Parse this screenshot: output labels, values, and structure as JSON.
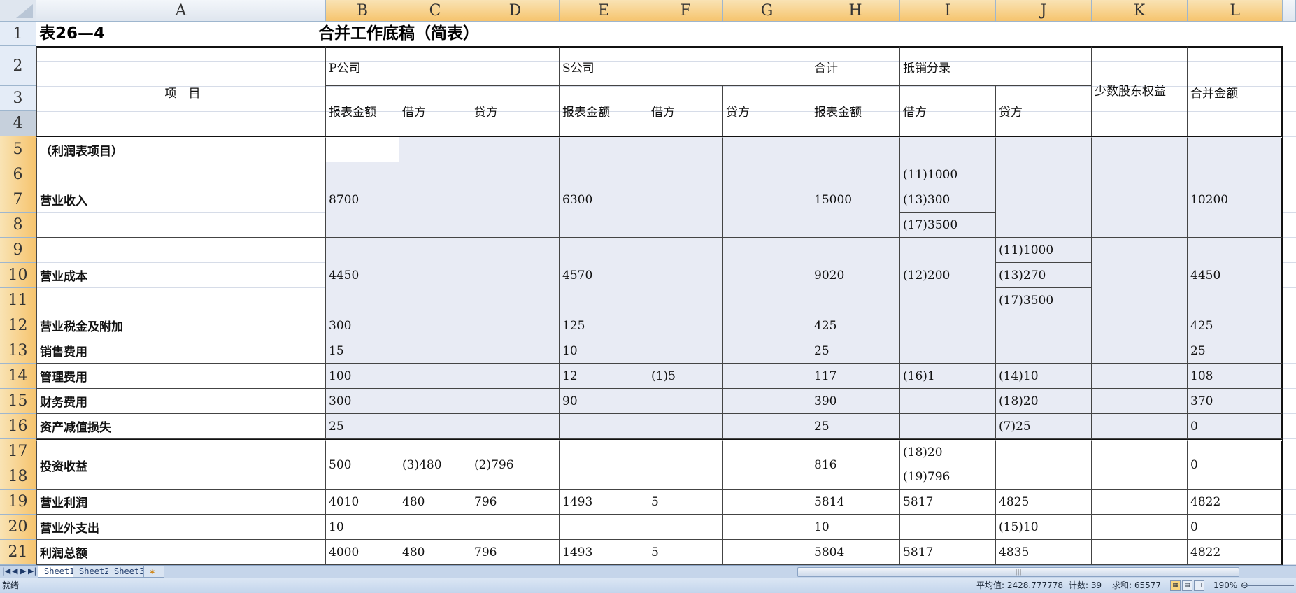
{
  "columns": [
    "A",
    "B",
    "C",
    "D",
    "E",
    "F",
    "G",
    "H",
    "I",
    "J",
    "K",
    "L"
  ],
  "rows": [
    "1",
    "2",
    "3",
    "4",
    "5",
    "6",
    "7",
    "8",
    "9",
    "10",
    "11",
    "12",
    "13",
    "14",
    "15",
    "16",
    "17",
    "18",
    "19",
    "20",
    "21"
  ],
  "title_left": "表26—4",
  "title_main": "合并工作底稿（简表）",
  "cells": [
    {
      "ref": "A2:A4",
      "text": "项　目",
      "cls": "center"
    },
    {
      "ref": "B2:D2",
      "text": "P公司"
    },
    {
      "ref": "E2:E2",
      "text": "S公司"
    },
    {
      "ref": "F2:G2",
      "text": ""
    },
    {
      "ref": "H2:H2",
      "text": "合计"
    },
    {
      "ref": "I2:J2",
      "text": "抵销分录"
    },
    {
      "ref": "K2:K4",
      "text": "少数股东权益",
      "cls": "wrap"
    },
    {
      "ref": "L2:L4",
      "text": "合并金额"
    },
    {
      "ref": "B3:B4",
      "text": "报表金额"
    },
    {
      "ref": "C3:C4",
      "text": "借方"
    },
    {
      "ref": "D3:D4",
      "text": "贷方"
    },
    {
      "ref": "E3:E4",
      "text": "报表金额"
    },
    {
      "ref": "F3:F4",
      "text": "借方"
    },
    {
      "ref": "G3:G4",
      "text": "贷方"
    },
    {
      "ref": "H3:H4",
      "text": "报表金额"
    },
    {
      "ref": "I3:I4",
      "text": "借方"
    },
    {
      "ref": "J3:J4",
      "text": "贷方"
    },
    {
      "ref": "A5",
      "text": "（利润表项目）",
      "cls": "bold"
    },
    {
      "ref": "B5",
      "text": ""
    },
    {
      "ref": "C5",
      "text": "",
      "f": 1
    },
    {
      "ref": "D5",
      "text": "",
      "f": 1
    },
    {
      "ref": "E5",
      "text": "",
      "f": 1
    },
    {
      "ref": "F5",
      "text": "",
      "f": 1
    },
    {
      "ref": "G5",
      "text": "",
      "f": 1
    },
    {
      "ref": "H5",
      "text": "",
      "f": 1
    },
    {
      "ref": "I5",
      "text": "",
      "f": 1
    },
    {
      "ref": "J5",
      "text": "",
      "f": 1
    },
    {
      "ref": "K5",
      "text": "",
      "f": 1
    },
    {
      "ref": "L5",
      "text": "",
      "f": 1
    },
    {
      "ref": "A6:A8",
      "text": "营业收入",
      "cls": "bold"
    },
    {
      "ref": "B6:B8",
      "text": "8700",
      "f": 1
    },
    {
      "ref": "C6:C8",
      "text": "",
      "f": 1
    },
    {
      "ref": "D6:D8",
      "text": "",
      "f": 1
    },
    {
      "ref": "E6:E8",
      "text": "6300",
      "f": 1
    },
    {
      "ref": "F6:F8",
      "text": "",
      "f": 1
    },
    {
      "ref": "G6:G8",
      "text": "",
      "f": 1
    },
    {
      "ref": "H6:H8",
      "text": "15000",
      "f": 1
    },
    {
      "ref": "I6",
      "text": "(11)1000",
      "f": 1
    },
    {
      "ref": "I7",
      "text": "(13)300",
      "f": 1
    },
    {
      "ref": "I8",
      "text": "(17)3500",
      "f": 1
    },
    {
      "ref": "J6:J8",
      "text": "",
      "f": 1
    },
    {
      "ref": "K6:K8",
      "text": "",
      "f": 1
    },
    {
      "ref": "L6:L8",
      "text": "10200",
      "f": 1
    },
    {
      "ref": "A9:A11",
      "text": "营业成本",
      "cls": "bold"
    },
    {
      "ref": "B9:B11",
      "text": "4450",
      "f": 1
    },
    {
      "ref": "C9:C11",
      "text": "",
      "f": 1
    },
    {
      "ref": "D9:D11",
      "text": "",
      "f": 1
    },
    {
      "ref": "E9:E11",
      "text": "4570",
      "f": 1
    },
    {
      "ref": "F9:F11",
      "text": "",
      "f": 1
    },
    {
      "ref": "G9:G11",
      "text": "",
      "f": 1
    },
    {
      "ref": "H9:H11",
      "text": "9020",
      "f": 1
    },
    {
      "ref": "I9:I11",
      "text": "(12)200",
      "f": 1
    },
    {
      "ref": "J9",
      "text": "(11)1000",
      "f": 1
    },
    {
      "ref": "J10",
      "text": "(13)270",
      "f": 1
    },
    {
      "ref": "J11",
      "text": "(17)3500",
      "f": 1
    },
    {
      "ref": "K9:K11",
      "text": "",
      "f": 1
    },
    {
      "ref": "L9:L11",
      "text": "4450",
      "f": 1
    },
    {
      "ref": "A12",
      "text": "营业税金及附加",
      "cls": "bold"
    },
    {
      "ref": "B12",
      "text": "300",
      "f": 1
    },
    {
      "ref": "C12",
      "text": "",
      "f": 1
    },
    {
      "ref": "D12",
      "text": "",
      "f": 1
    },
    {
      "ref": "E12",
      "text": "125",
      "f": 1
    },
    {
      "ref": "F12",
      "text": "",
      "f": 1
    },
    {
      "ref": "G12",
      "text": "",
      "f": 1
    },
    {
      "ref": "H12",
      "text": "425",
      "f": 1
    },
    {
      "ref": "I12",
      "text": "",
      "f": 1
    },
    {
      "ref": "J12",
      "text": "",
      "f": 1
    },
    {
      "ref": "K12",
      "text": "",
      "f": 1
    },
    {
      "ref": "L12",
      "text": "425",
      "f": 1
    },
    {
      "ref": "A13",
      "text": "销售费用",
      "cls": "bold"
    },
    {
      "ref": "B13",
      "text": "15",
      "f": 1
    },
    {
      "ref": "C13",
      "text": "",
      "f": 1
    },
    {
      "ref": "D13",
      "text": "",
      "f": 1
    },
    {
      "ref": "E13",
      "text": "10",
      "f": 1
    },
    {
      "ref": "F13",
      "text": "",
      "f": 1
    },
    {
      "ref": "G13",
      "text": "",
      "f": 1
    },
    {
      "ref": "H13",
      "text": "25",
      "f": 1
    },
    {
      "ref": "I13",
      "text": "",
      "f": 1
    },
    {
      "ref": "J13",
      "text": "",
      "f": 1
    },
    {
      "ref": "K13",
      "text": "",
      "f": 1
    },
    {
      "ref": "L13",
      "text": "25",
      "f": 1
    },
    {
      "ref": "A14",
      "text": "管理费用",
      "cls": "bold"
    },
    {
      "ref": "B14",
      "text": "100",
      "f": 1
    },
    {
      "ref": "C14",
      "text": "",
      "f": 1
    },
    {
      "ref": "D14",
      "text": "",
      "f": 1
    },
    {
      "ref": "E14",
      "text": "12",
      "f": 1
    },
    {
      "ref": "F14",
      "text": "(1)5",
      "f": 1
    },
    {
      "ref": "G14",
      "text": "",
      "f": 1
    },
    {
      "ref": "H14",
      "text": "117",
      "f": 1
    },
    {
      "ref": "I14",
      "text": "(16)1",
      "f": 1
    },
    {
      "ref": "J14",
      "text": "(14)10",
      "f": 1
    },
    {
      "ref": "K14",
      "text": "",
      "f": 1
    },
    {
      "ref": "L14",
      "text": "108",
      "f": 1
    },
    {
      "ref": "A15",
      "text": "财务费用",
      "cls": "bold"
    },
    {
      "ref": "B15",
      "text": "300",
      "f": 1
    },
    {
      "ref": "C15",
      "text": "",
      "f": 1
    },
    {
      "ref": "D15",
      "text": "",
      "f": 1
    },
    {
      "ref": "E15",
      "text": "90",
      "f": 1
    },
    {
      "ref": "F15",
      "text": "",
      "f": 1
    },
    {
      "ref": "G15",
      "text": "",
      "f": 1
    },
    {
      "ref": "H15",
      "text": "390",
      "f": 1
    },
    {
      "ref": "I15",
      "text": "",
      "f": 1
    },
    {
      "ref": "J15",
      "text": "(18)20",
      "f": 1
    },
    {
      "ref": "K15",
      "text": "",
      "f": 1
    },
    {
      "ref": "L15",
      "text": "370",
      "f": 1
    },
    {
      "ref": "A16",
      "text": "资产减值损失",
      "cls": "bold"
    },
    {
      "ref": "B16",
      "text": "25",
      "f": 1
    },
    {
      "ref": "C16",
      "text": "",
      "f": 1
    },
    {
      "ref": "D16",
      "text": "",
      "f": 1
    },
    {
      "ref": "E16",
      "text": "",
      "f": 1
    },
    {
      "ref": "F16",
      "text": "",
      "f": 1
    },
    {
      "ref": "G16",
      "text": "",
      "f": 1
    },
    {
      "ref": "H16",
      "text": "25",
      "f": 1
    },
    {
      "ref": "I16",
      "text": "",
      "f": 1
    },
    {
      "ref": "J16",
      "text": "(7)25",
      "f": 1
    },
    {
      "ref": "K16",
      "text": "",
      "f": 1
    },
    {
      "ref": "L16",
      "text": "0",
      "f": 1
    },
    {
      "ref": "A17:A18",
      "text": "投资收益",
      "cls": "bold"
    },
    {
      "ref": "B17:B18",
      "text": "500"
    },
    {
      "ref": "C17:C18",
      "text": "(3)480"
    },
    {
      "ref": "D17:D18",
      "text": "(2)796"
    },
    {
      "ref": "E17:E18",
      "text": ""
    },
    {
      "ref": "F17:F18",
      "text": ""
    },
    {
      "ref": "G17:G18",
      "text": ""
    },
    {
      "ref": "H17:H18",
      "text": "816"
    },
    {
      "ref": "I17",
      "text": "(18)20"
    },
    {
      "ref": "I18",
      "text": "(19)796"
    },
    {
      "ref": "J17:J18",
      "text": ""
    },
    {
      "ref": "K17:K18",
      "text": ""
    },
    {
      "ref": "L17:L18",
      "text": "0"
    },
    {
      "ref": "A19",
      "text": "营业利润",
      "cls": "bold"
    },
    {
      "ref": "B19",
      "text": "4010"
    },
    {
      "ref": "C19",
      "text": "480"
    },
    {
      "ref": "D19",
      "text": "796"
    },
    {
      "ref": "E19",
      "text": "1493"
    },
    {
      "ref": "F19",
      "text": "5"
    },
    {
      "ref": "G19",
      "text": ""
    },
    {
      "ref": "H19",
      "text": "5814"
    },
    {
      "ref": "I19",
      "text": "5817"
    },
    {
      "ref": "J19",
      "text": "4825"
    },
    {
      "ref": "K19",
      "text": ""
    },
    {
      "ref": "L19",
      "text": "4822"
    },
    {
      "ref": "A20",
      "text": "营业外支出",
      "cls": "bold"
    },
    {
      "ref": "B20",
      "text": "10"
    },
    {
      "ref": "C20",
      "text": ""
    },
    {
      "ref": "D20",
      "text": ""
    },
    {
      "ref": "E20",
      "text": ""
    },
    {
      "ref": "F20",
      "text": ""
    },
    {
      "ref": "G20",
      "text": ""
    },
    {
      "ref": "H20",
      "text": "10"
    },
    {
      "ref": "I20",
      "text": ""
    },
    {
      "ref": "J20",
      "text": "(15)10"
    },
    {
      "ref": "K20",
      "text": ""
    },
    {
      "ref": "L20",
      "text": "0"
    },
    {
      "ref": "A21",
      "text": "利润总额",
      "cls": "bold"
    },
    {
      "ref": "B21",
      "text": "4000"
    },
    {
      "ref": "C21",
      "text": "480"
    },
    {
      "ref": "D21",
      "text": "796"
    },
    {
      "ref": "E21",
      "text": "1493"
    },
    {
      "ref": "F21",
      "text": "5"
    },
    {
      "ref": "G21",
      "text": ""
    },
    {
      "ref": "H21",
      "text": "5804"
    },
    {
      "ref": "I21",
      "text": "5817"
    },
    {
      "ref": "J21",
      "text": "4835"
    },
    {
      "ref": "K21",
      "text": ""
    },
    {
      "ref": "L21",
      "text": "4822"
    }
  ],
  "sheet_tabs": [
    "Sheet1",
    "Sheet2",
    "Sheet3"
  ],
  "status": {
    "ready": "就绪",
    "average": "平均值: 2428.777778",
    "count": "计数: 39",
    "sum": "求和: 65577",
    "zoom": "190%"
  },
  "colors": {
    "selection_fill": "#e8ebf4",
    "header_selected": "#f6c46e"
  }
}
